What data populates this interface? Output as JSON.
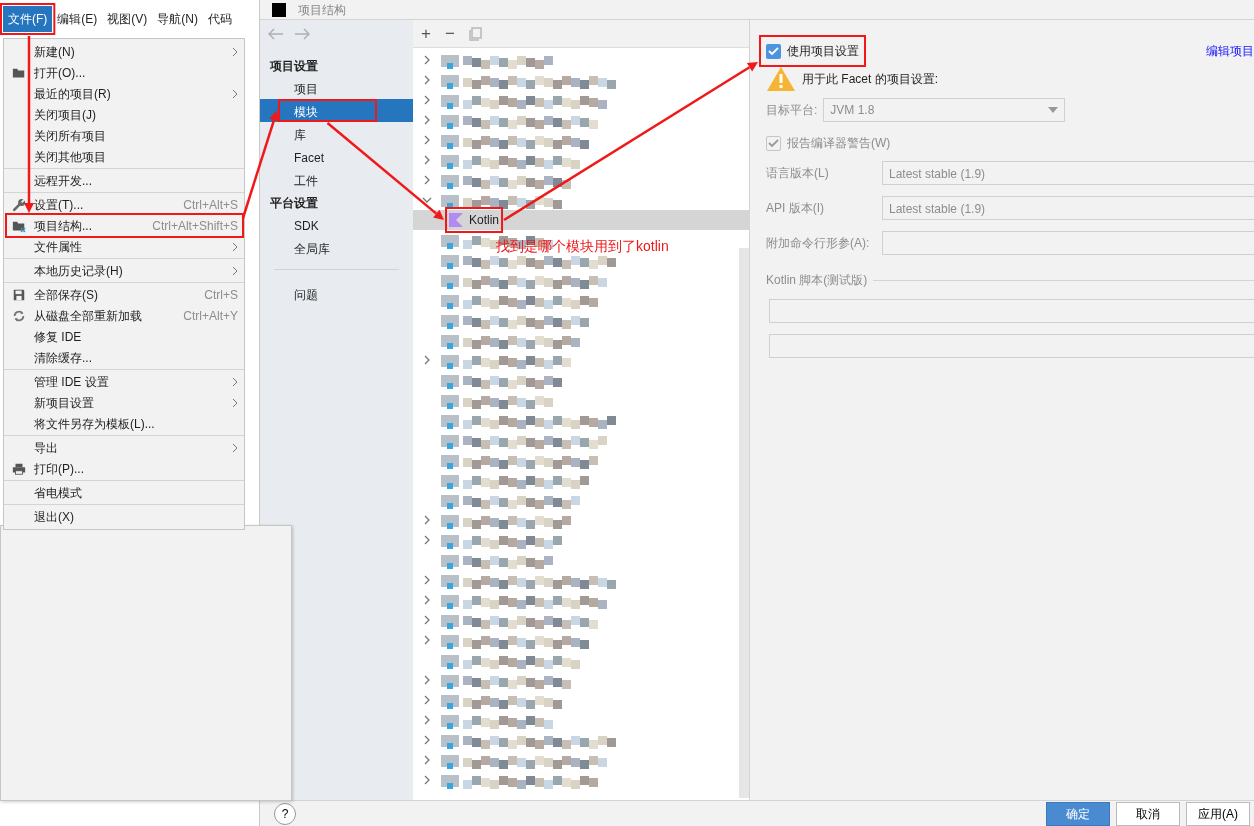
{
  "menu_bar": [
    {
      "label": "文件(F)",
      "selected": true
    },
    {
      "label": "编辑(E)",
      "selected": false
    },
    {
      "label": "视图(V)",
      "selected": false
    },
    {
      "label": "导航(N)",
      "selected": false
    },
    {
      "label": "代码",
      "selected": false
    }
  ],
  "file_menu": [
    {
      "kind": "item",
      "label": "新建(N)",
      "submenu": true
    },
    {
      "kind": "item",
      "label": "打开(O)..."
    },
    {
      "kind": "item",
      "label": "最近的项目(R)",
      "submenu": true
    },
    {
      "kind": "item",
      "label": "关闭项目(J)"
    },
    {
      "kind": "item",
      "label": "关闭所有项目"
    },
    {
      "kind": "item",
      "label": "关闭其他项目"
    },
    {
      "kind": "separator"
    },
    {
      "kind": "item",
      "label": "远程开发..."
    },
    {
      "kind": "separator"
    },
    {
      "kind": "item",
      "label": "设置(T)...",
      "shortcut": "Ctrl+Alt+S"
    },
    {
      "kind": "item",
      "label": "项目结构...",
      "shortcut": "Ctrl+Alt+Shift+S"
    },
    {
      "kind": "item",
      "label": "文件属性",
      "submenu": true
    },
    {
      "kind": "separator"
    },
    {
      "kind": "item",
      "label": "本地历史记录(H)",
      "submenu": true
    },
    {
      "kind": "separator"
    },
    {
      "kind": "item",
      "label": "全部保存(S)",
      "shortcut": "Ctrl+S"
    },
    {
      "kind": "item",
      "label": "从磁盘全部重新加载",
      "shortcut": "Ctrl+Alt+Y"
    },
    {
      "kind": "item",
      "label": "修复 IDE"
    },
    {
      "kind": "item",
      "label": "清除缓存..."
    },
    {
      "kind": "separator"
    },
    {
      "kind": "item",
      "label": "管理 IDE 设置",
      "submenu": true
    },
    {
      "kind": "item",
      "label": "新项目设置",
      "submenu": true
    },
    {
      "kind": "item",
      "label": "将文件另存为模板(L)..."
    },
    {
      "kind": "separator"
    },
    {
      "kind": "item",
      "label": "导出",
      "submenu": true
    },
    {
      "kind": "item",
      "label": "打印(P)..."
    },
    {
      "kind": "separator"
    },
    {
      "kind": "item",
      "label": "省电模式"
    },
    {
      "kind": "separator"
    },
    {
      "kind": "item",
      "label": "退出(X)"
    }
  ],
  "dialog": {
    "title": "项目结构",
    "nav": [
      {
        "kind": "heading",
        "label": "项目设置"
      },
      {
        "kind": "item",
        "label": "项目",
        "selected": false
      },
      {
        "kind": "item",
        "label": "模块",
        "selected": true
      },
      {
        "kind": "item",
        "label": "库",
        "selected": false
      },
      {
        "kind": "item",
        "label": "Facet",
        "selected": false
      },
      {
        "kind": "item",
        "label": "工件",
        "selected": false
      },
      {
        "kind": "heading",
        "label": "平台设置"
      },
      {
        "kind": "item",
        "label": "SDK",
        "selected": false
      },
      {
        "kind": "item",
        "label": "全局库",
        "selected": false
      },
      {
        "kind": "separator"
      },
      {
        "kind": "item",
        "label": "问题",
        "selected": false
      }
    ],
    "toolbar": {
      "add": "+",
      "remove": "−"
    },
    "module_tree": [
      {
        "expandable": true
      },
      {
        "expandable": true
      },
      {
        "expandable": true
      },
      {
        "expandable": true
      },
      {
        "expandable": true
      },
      {
        "expandable": true
      },
      {
        "expandable": true
      },
      {
        "expandable": true,
        "expanded": true,
        "children": [
          {
            "label": "Kotlin",
            "selected": true
          }
        ]
      },
      {
        "expandable": false
      },
      {
        "expandable": false
      },
      {
        "expandable": false
      },
      {
        "expandable": false
      },
      {
        "expandable": false
      },
      {
        "expandable": false
      },
      {
        "expandable": true
      },
      {
        "expandable": false
      },
      {
        "expandable": false
      },
      {
        "expandable": false
      },
      {
        "expandable": false
      },
      {
        "expandable": false
      },
      {
        "expandable": false
      },
      {
        "expandable": false
      },
      {
        "expandable": true
      },
      {
        "expandable": true
      },
      {
        "expandable": false
      },
      {
        "expandable": true
      },
      {
        "expandable": true
      },
      {
        "expandable": true
      },
      {
        "expandable": true
      },
      {
        "expandable": false
      },
      {
        "expandable": true
      },
      {
        "expandable": true
      },
      {
        "expandable": true
      },
      {
        "expandable": true
      },
      {
        "expandable": true
      },
      {
        "expandable": true
      }
    ],
    "settings": {
      "use_project_settings": {
        "label": "使用项目设置",
        "checked": true
      },
      "edit_link": "编辑项目",
      "warning": "用于此 Facet 的项目设置:",
      "target_platform": {
        "label": "目标平台:",
        "value": "JVM 1.8"
      },
      "report_warnings": {
        "label": "报告编译器警告(W)",
        "checked": true
      },
      "fields": [
        {
          "label": "语言版本(L)",
          "value": "Latest stable (1.9)"
        },
        {
          "label": "API 版本(I)",
          "value": "Latest stable (1.9)"
        },
        {
          "label": "附加命令行形参(A):"
        }
      ],
      "script_section": "Kotlin 脚本(测试版)"
    },
    "footer": {
      "help": "?",
      "buttons": [
        {
          "label": "确定",
          "primary": true
        },
        {
          "label": "取消",
          "primary": false
        },
        {
          "label": "应用(A)",
          "primary": false
        }
      ]
    }
  },
  "annotation": {
    "note": "找到是哪个模块用到了kotlin"
  }
}
